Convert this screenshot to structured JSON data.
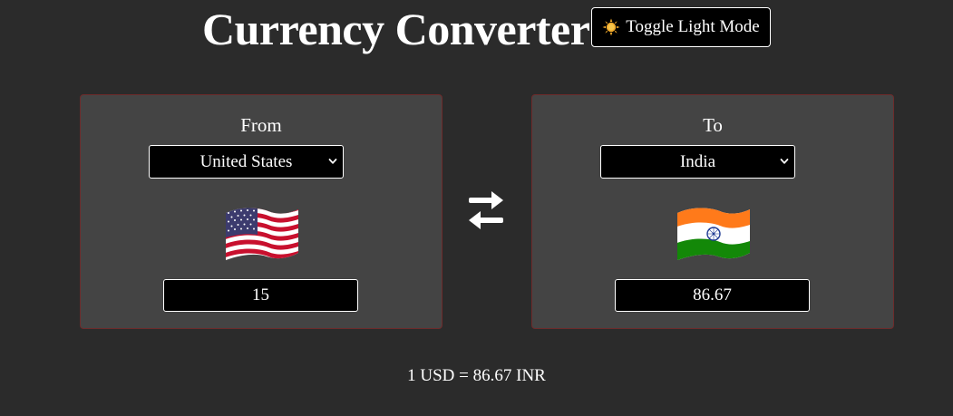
{
  "header": {
    "title": "Currency Converter",
    "toggle_label": "Toggle Light Mode",
    "toggle_icon": "sun-icon"
  },
  "from": {
    "label": "From",
    "country": "United States",
    "flag": "us-flag-icon",
    "amount": "15"
  },
  "to": {
    "label": "To",
    "country": "India",
    "flag": "india-flag-icon",
    "amount": "86.67"
  },
  "swap_icon": "swap-arrows-icon",
  "rate_text": "1 USD = 86.67 INR",
  "colors": {
    "background": "#2b2b2b",
    "panel": "#444444",
    "panel_border": "#6d2b2b",
    "field": "#000000",
    "text": "#ffffff"
  }
}
